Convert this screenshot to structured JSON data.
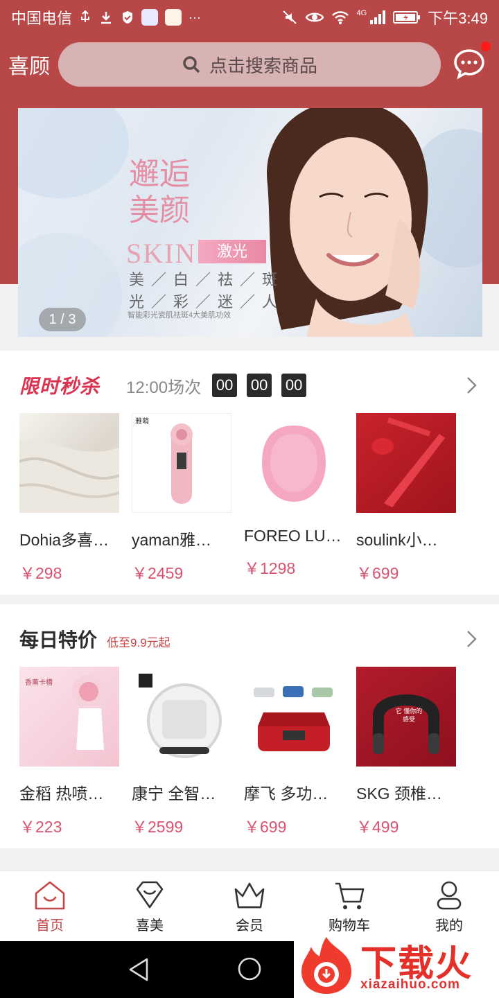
{
  "status_bar": {
    "carrier": "中国电信",
    "more": "···",
    "network": "4G",
    "time": "下午3:49"
  },
  "header": {
    "brand": "喜顾",
    "search_placeholder": "点击搜索商品",
    "icons": [
      "search-icon",
      "message-icon"
    ]
  },
  "banner": {
    "art_title": "邂逅美颜",
    "skin_text": "SKIN",
    "badge": "激光",
    "line1": "美／白／祛／斑",
    "line2": "光／彩／迷／人",
    "subtitle": "智能彩光瓷肌祛斑4大美肌功效",
    "indicator": "1 / 3"
  },
  "flash_sale": {
    "title": "限时秒杀",
    "session": "12:00场次",
    "hours": "00",
    "minutes": "00",
    "seconds": "00",
    "products": [
      {
        "name": "Dohia多喜…",
        "price": "￥298"
      },
      {
        "name": "yaman雅…",
        "price": "￥2459"
      },
      {
        "name": "FOREO LU…",
        "price": "￥1298"
      },
      {
        "name": "soulink小…",
        "price": "￥699"
      }
    ],
    "image_labels": {
      "yaman_brand": "雅萌"
    }
  },
  "daily_deals": {
    "title": "每日特价",
    "subtitle": "低至9.9元起",
    "products": [
      {
        "name": "金稻 热喷…",
        "price": "￥223"
      },
      {
        "name": "康宁 全智…",
        "price": "￥2599"
      },
      {
        "name": "摩飞 多功…",
        "price": "￥699"
      },
      {
        "name": "SKG 颈椎…",
        "price": "￥499"
      }
    ],
    "image_labels": {
      "jindao_text": "香薰卡槽",
      "skg_text": "它 懂你的感受"
    }
  },
  "tabbar": {
    "items": [
      {
        "label": "首页",
        "icon": "home-icon",
        "active": true
      },
      {
        "label": "喜美",
        "icon": "heart-diamond-icon",
        "active": false
      },
      {
        "label": "会员",
        "icon": "crown-icon",
        "active": false
      },
      {
        "label": "购物车",
        "icon": "cart-icon",
        "active": false
      },
      {
        "label": "我的",
        "icon": "user-icon",
        "active": false
      }
    ]
  },
  "watermark": {
    "main": "下载火",
    "sub": "xiazaihuo.com"
  },
  "colors": {
    "brand_red": "#b84848",
    "price_pink": "#d9526f",
    "flash_red": "#d9334f"
  }
}
